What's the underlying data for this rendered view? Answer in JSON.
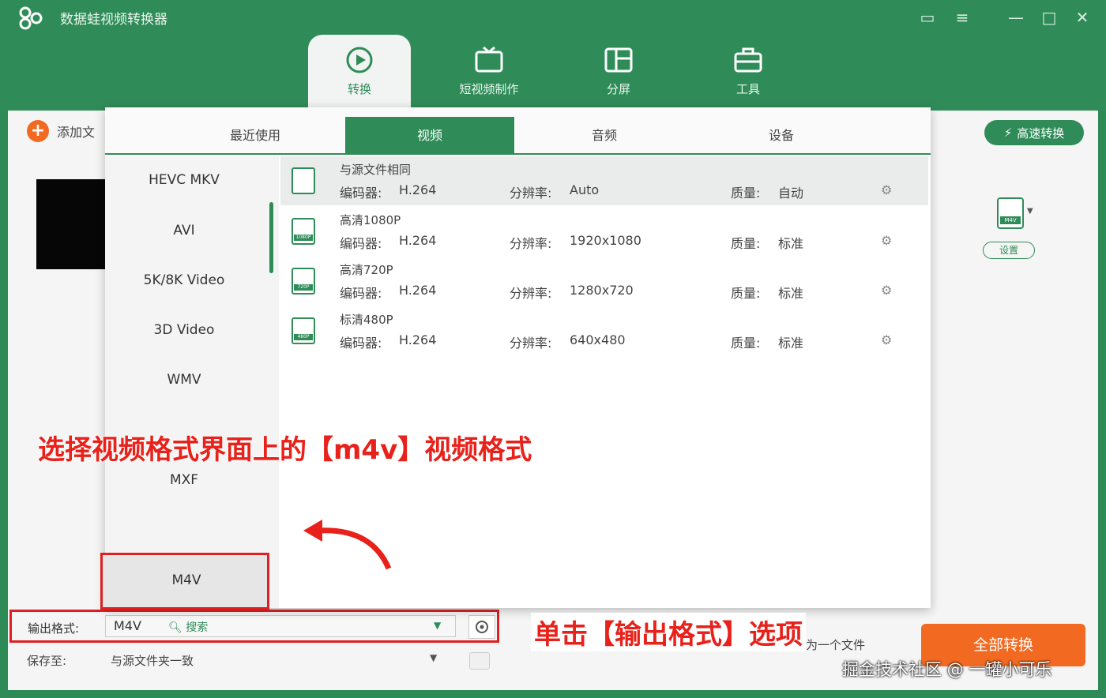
{
  "app": {
    "title": "数据蛙视频转换器"
  },
  "nav_tabs": [
    {
      "label": "转换"
    },
    {
      "label": "短视频制作"
    },
    {
      "label": "分屏"
    },
    {
      "label": "工具"
    }
  ],
  "toolbar": {
    "add_file": "添加文",
    "turbo": "高速转换",
    "settings": "设置",
    "format_icon_tag": "M4V"
  },
  "panel": {
    "tabs": [
      "最近使用",
      "视频",
      "音频",
      "设备"
    ],
    "active_tab": "视频",
    "formats": [
      "HEVC MKV",
      "AVI",
      "5K/8K Video",
      "3D Video",
      "WMV",
      "MXF",
      "M4V"
    ],
    "selected_format": "M4V",
    "search": "搜索",
    "presets": [
      {
        "name": "与源文件相同",
        "codec_label": "编码器:",
        "codec": "H.264",
        "res_label": "分辨率:",
        "res": "Auto",
        "q_label": "质量:",
        "quality": "自动",
        "tag": ""
      },
      {
        "name": "高清1080P",
        "codec_label": "编码器:",
        "codec": "H.264",
        "res_label": "分辨率:",
        "res": "1920x1080",
        "q_label": "质量:",
        "quality": "标准",
        "tag": "1080P"
      },
      {
        "name": "高清720P",
        "codec_label": "编码器:",
        "codec": "H.264",
        "res_label": "分辨率:",
        "res": "1280x720",
        "q_label": "质量:",
        "quality": "标准",
        "tag": "720P"
      },
      {
        "name": "标清480P",
        "codec_label": "编码器:",
        "codec": "H.264",
        "res_label": "分辨率:",
        "res": "640x480",
        "q_label": "质量:",
        "quality": "标准",
        "tag": "480P"
      }
    ]
  },
  "bottom": {
    "output_label": "输出格式:",
    "output_value": "M4V",
    "save_label": "保存至:",
    "save_value": "与源文件夹一致",
    "merge_text": "合并为一个文件",
    "convert_all": "全部转换"
  },
  "annotations": {
    "select_format": "选择视频格式界面上的【m4v】视频格式",
    "click_output": "单击【输出格式】选项"
  },
  "watermark": "掘金技术社区 @ 一罐小可乐",
  "colors": {
    "brand_green": "#2f8c58",
    "accent_orange": "#f26a22",
    "annotation_red": "#e8211a"
  }
}
